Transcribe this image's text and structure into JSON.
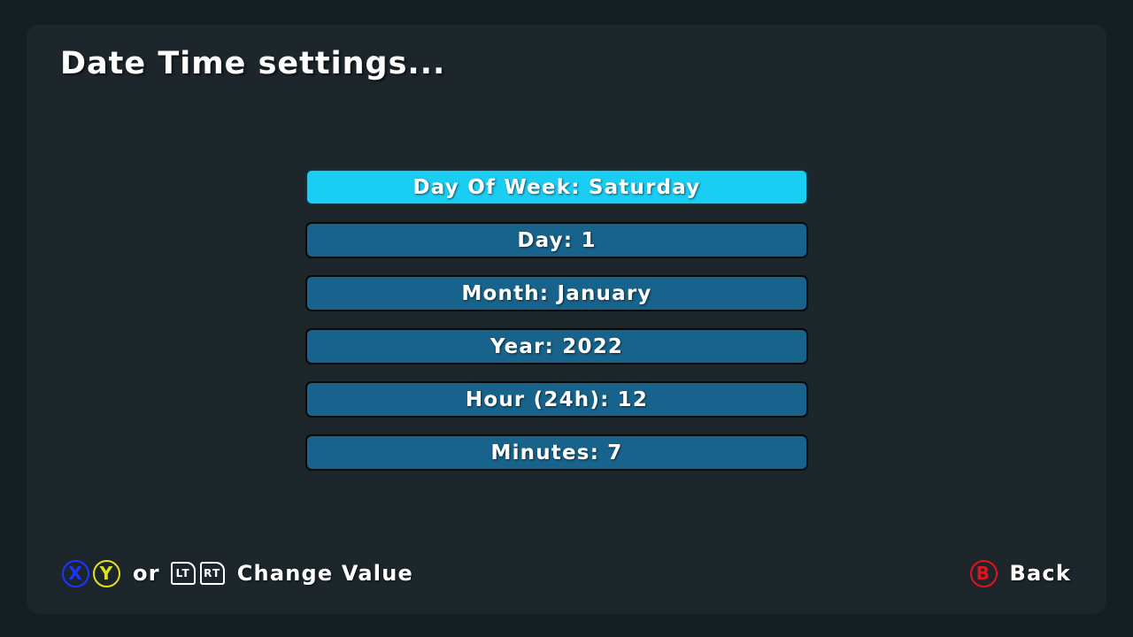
{
  "title": "Date Time settings...",
  "menu": {
    "selected_index": 0,
    "items": [
      {
        "label": "Day Of Week: Saturday"
      },
      {
        "label": "Day: 1"
      },
      {
        "label": "Month: January"
      },
      {
        "label": "Year: 2022"
      },
      {
        "label": "Hour (24h): 12"
      },
      {
        "label": "Minutes: 7"
      }
    ]
  },
  "footer": {
    "x_button": "X",
    "y_button": "Y",
    "or_text": "or",
    "lt_button": "LT",
    "rt_button": "RT",
    "change_value": "Change Value",
    "b_button": "B",
    "back": "Back"
  },
  "colors": {
    "background": "#151f23",
    "panel": "#1c262b",
    "item": "#17638b",
    "item_selected": "#19cdf3",
    "x_button": "#1e35ff",
    "y_button": "#e2e21a",
    "b_button": "#e0141c"
  },
  "icons": {
    "x_button": "x-button-icon",
    "y_button": "y-button-icon",
    "lt_button": "lt-trigger-icon",
    "rt_button": "rt-trigger-icon",
    "b_button": "b-button-icon"
  }
}
